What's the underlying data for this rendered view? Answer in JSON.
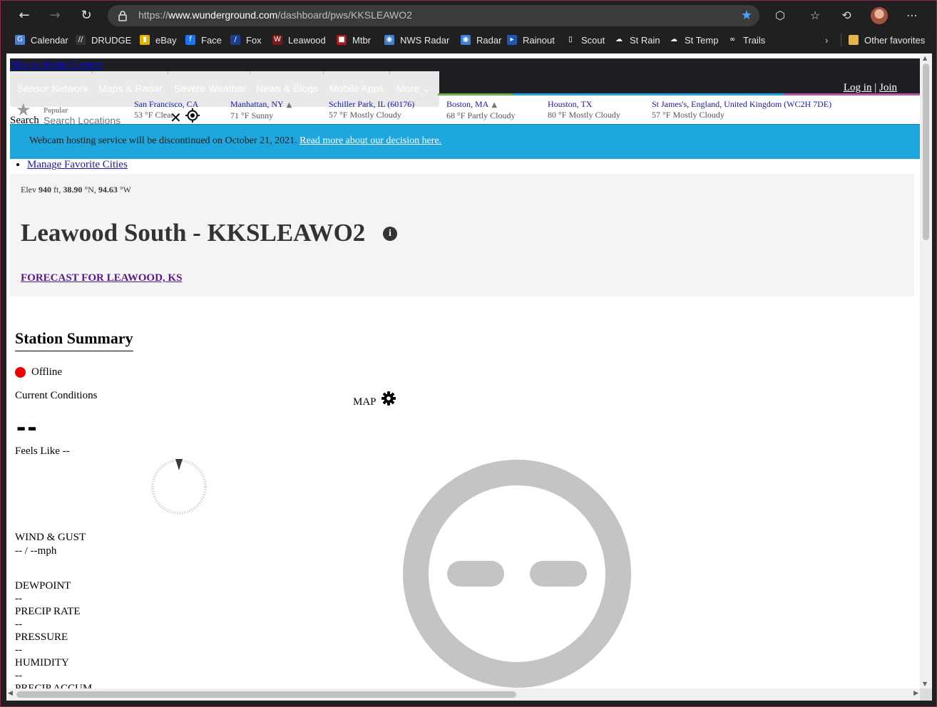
{
  "browser": {
    "url_prefix": "https://",
    "url_domain": "www.wunderground.com",
    "url_path": "/dashboard/pws/KKSLEAWO2",
    "bookmarks": [
      {
        "label": "Calendar",
        "icon": "calendar-icon",
        "color": "#4a7fd6"
      },
      {
        "label": "DRUDGE",
        "icon": "drudge-icon",
        "color": "#333333"
      },
      {
        "label": "eBay",
        "icon": "ebay-icon",
        "color": "#e5b100"
      },
      {
        "label": "Face",
        "icon": "facebook-icon",
        "color": "#1877f2"
      },
      {
        "label": "Fox",
        "icon": "fox-icon",
        "color": "#1a3d8f"
      },
      {
        "label": "Leawood",
        "icon": "leawood-icon",
        "color": "#7a1a1a"
      },
      {
        "label": "Mtbr",
        "icon": "mtbr-icon",
        "color": "#b01818"
      },
      {
        "label": "NWS Radar",
        "icon": "nws-icon",
        "color": "#3c7fd6"
      },
      {
        "label": "Radar",
        "icon": "noaa-icon",
        "color": "#3c7fd6"
      },
      {
        "label": "Rainout",
        "icon": "rainout-icon",
        "color": "#2355b8"
      },
      {
        "label": "Scout",
        "icon": "page-icon",
        "color": "#202020"
      },
      {
        "label": "St Rain",
        "icon": "cloud-icon",
        "color": "#202020"
      },
      {
        "label": "St Temp",
        "icon": "cloud-icon",
        "color": "#202020"
      },
      {
        "label": "Trails",
        "icon": "link-icon",
        "color": "#202020"
      }
    ],
    "other_favorites": "Other favorites"
  },
  "site": {
    "skip_link": "Skip to Main Content",
    "menu": [
      "Sensor Network",
      "Maps & Radar",
      "Severe Weather",
      "News & Blogs",
      "Mobile Apps",
      "More"
    ],
    "login": "Log in",
    "login_sep": "|",
    "join": "Join",
    "popular_label": "Popular",
    "search_label": "Search",
    "search_placeholder": "Search Locations",
    "cities": [
      {
        "name": "San Francisco, CA",
        "cond": "53 °F Clear",
        "warning": false
      },
      {
        "name": "Manhattan, NY",
        "cond": "71 °F Sunny",
        "warning": true
      },
      {
        "name": "Schiller Park, IL (60176)",
        "cond": "57 °F Mostly Cloudy",
        "warning": false
      },
      {
        "name": "Boston, MA",
        "cond": "68 °F Partly Cloudy",
        "warning": true
      },
      {
        "name": "Houston, TX",
        "cond": "80 °F Mostly Cloudy",
        "warning": false
      },
      {
        "name": "St James's, England, United Kingdom (WC2H 7DE)",
        "cond": "57 °F Mostly Cloudy",
        "warning": false
      }
    ],
    "banner_text": "Webcam hosting service will be discontinued on October 21, 2021.",
    "banner_link": "Read more about our decision here.",
    "manage_fav": "Manage Favorite Cities"
  },
  "station": {
    "elev_prefix": "Elev",
    "elev_value": "940",
    "elev_unit": "ft,",
    "lat_value": "38.90",
    "lat_unit": "°N,",
    "lon_value": "94.63",
    "lon_unit": "°W",
    "title": "Leawood South - KKSLEAWO2",
    "forecast_link": "FORECAST FOR LEAWOOD, KS"
  },
  "summary": {
    "title": "Station Summary",
    "status": "Offline",
    "current_conditions": "Current Conditions",
    "temp": "--",
    "feels_like": "Feels Like --",
    "wind_label": "WIND & GUST",
    "wind_value": "-- / --mph",
    "dewpoint_label": "DEWPOINT",
    "dewpoint_value": "--",
    "precip_rate_label": "PRECIP RATE",
    "precip_rate_value": "--",
    "pressure_label": "PRESSURE",
    "pressure_value": "--",
    "humidity_label": "HUMIDITY",
    "humidity_value": "--",
    "precip_accum_label": "PRECIP ACCUM",
    "map_label": "MAP"
  },
  "colors": {
    "banner": "#1ea7dd",
    "offline": "#ee0000",
    "face": "#c4c4c4"
  }
}
